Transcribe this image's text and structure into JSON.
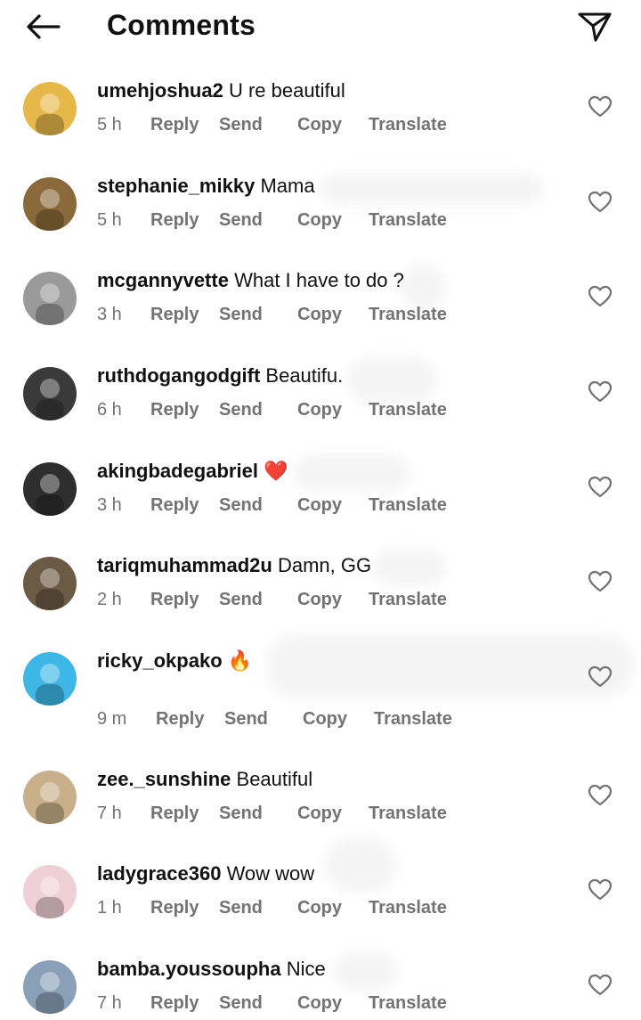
{
  "header": {
    "title": "Comments",
    "back_icon": "arrow-left-icon",
    "send_icon": "paper-plane-icon"
  },
  "actions": {
    "reply": "Reply",
    "send": "Send",
    "copy": "Copy",
    "translate": "Translate"
  },
  "comments": [
    {
      "username": "umehjoshua2",
      "text": "U re beautiful",
      "time": "5 h",
      "avatar_color": "#e6b84a"
    },
    {
      "username": "stephanie_mikky",
      "text": "Mama",
      "time": "5 h",
      "avatar_color": "#8a6a3a"
    },
    {
      "username": "mcgannyvette",
      "text": "What I have to do ?",
      "time": "3 h",
      "avatar_color": "#9a9a9a"
    },
    {
      "username": "ruthdogangodgift",
      "text": "Beautifu.",
      "time": "6 h",
      "avatar_color": "#3a3a3a"
    },
    {
      "username": "akingbadegabriel",
      "text": "❤️",
      "time": "3 h",
      "avatar_color": "#2e2e2e"
    },
    {
      "username": "tariqmuhammad2u",
      "text": "Damn, GG",
      "time": "2 h",
      "avatar_color": "#6b5a44"
    },
    {
      "username": "ricky_okpako",
      "text": "🔥",
      "time": "9 m",
      "avatar_color": "#3fb7e6"
    },
    {
      "username": "zee._sunshine",
      "text": "Beautiful",
      "time": "7 h",
      "avatar_color": "#c9b08a"
    },
    {
      "username": "ladygrace360",
      "text": "Wow wow",
      "time": "1 h",
      "avatar_color": "#f0d0d8"
    },
    {
      "username": "bamba.youssoupha",
      "text": "Nice",
      "time": "7 h",
      "avatar_color": "#8aa0b8"
    }
  ]
}
